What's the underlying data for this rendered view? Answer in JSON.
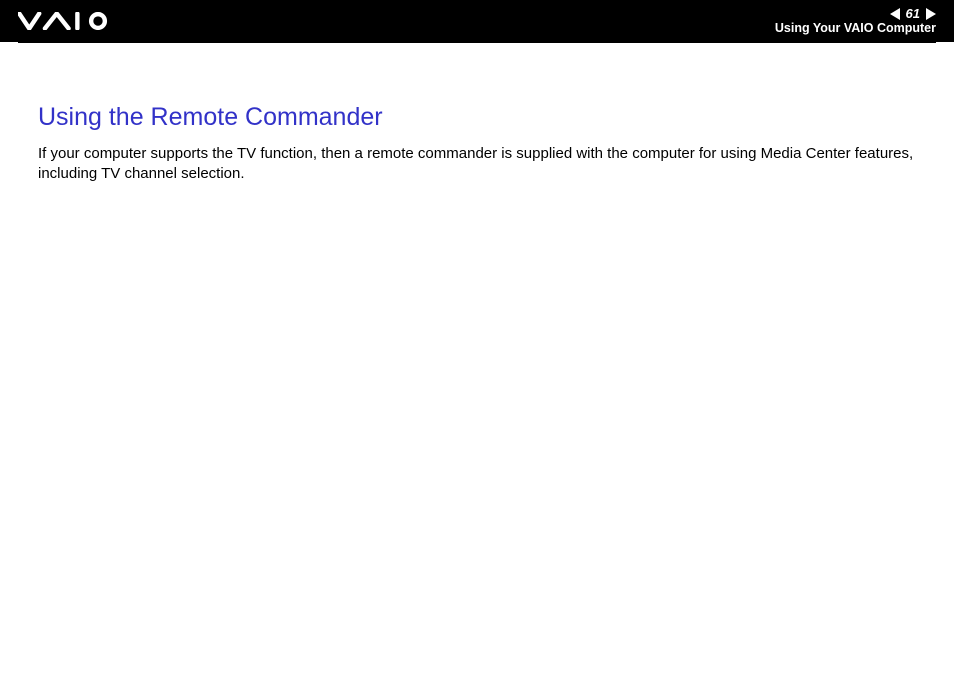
{
  "header": {
    "breadcrumb": "Using Your VAIO Computer",
    "page_number": "61",
    "logo_alt": "VAIO"
  },
  "content": {
    "title": "Using the Remote Commander",
    "paragraph": "If your computer supports the TV function, then a remote commander is supplied with the computer for using Media Center features, including TV channel selection."
  }
}
